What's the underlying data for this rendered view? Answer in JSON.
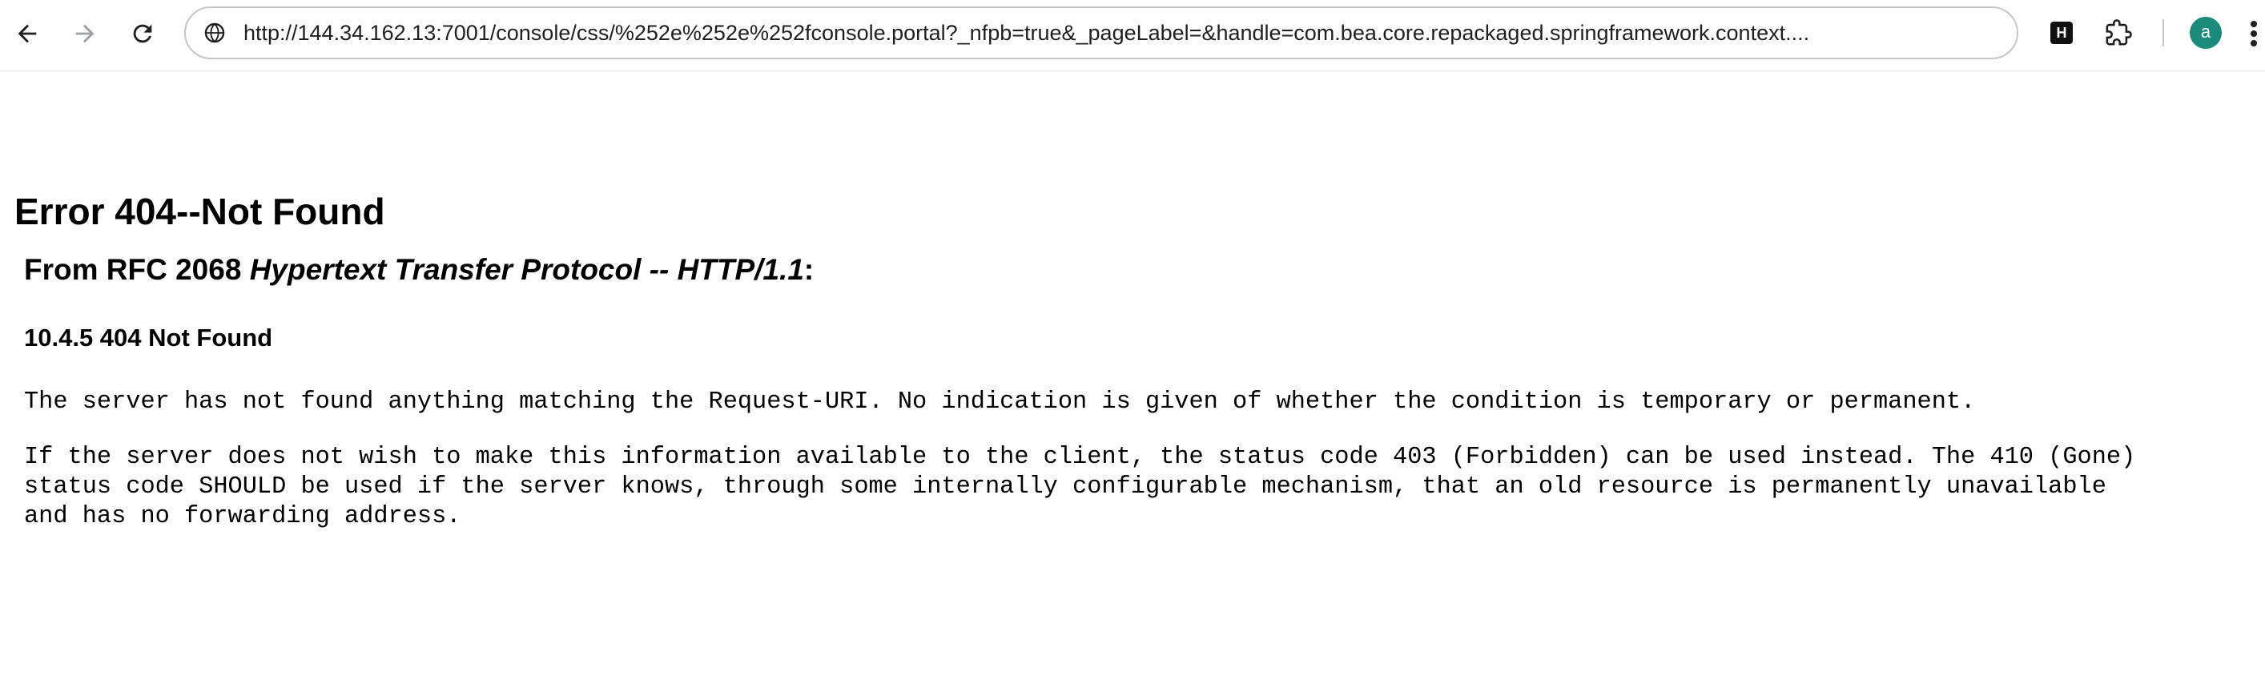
{
  "browser": {
    "url": "http://144.34.162.13:7001/console/css/%252e%252e%252fconsole.portal?_nfpb=true&_pageLabel=&handle=com.bea.core.repackaged.springframework.context....",
    "extension_h_label": "H",
    "avatar_letter": "a",
    "icons": {
      "back": "arrow-left-icon",
      "forward": "arrow-right-icon",
      "reload": "reload-icon",
      "site_info": "site-info-icon",
      "extensions": "puzzle-icon",
      "menu": "more-vert-icon"
    },
    "colors": {
      "avatar": "#1a8a7a",
      "omnibox_border": "#c4c7c5"
    }
  },
  "page": {
    "title": "Error 404--Not Found",
    "rfc_heading_prefix": "From RFC 2068 ",
    "rfc_heading_title": "Hypertext Transfer Protocol -- HTTP/1.1",
    "rfc_heading_suffix": ":",
    "section_heading": "10.4.5 404 Not Found",
    "paragraph_1": "The server has not found anything matching the Request-URI. No indication is given of whether the condition is temporary or permanent.",
    "paragraph_2_line_1": "If the server does not wish to make this information available to the client, the status code 403 (Forbidden) can be used instead. The 410 (Gone)",
    "paragraph_2_line_2": "status code SHOULD be used if the server knows, through some internally configurable mechanism, that an old resource is permanently unavailable",
    "paragraph_2_line_3": "and has no forwarding address."
  }
}
